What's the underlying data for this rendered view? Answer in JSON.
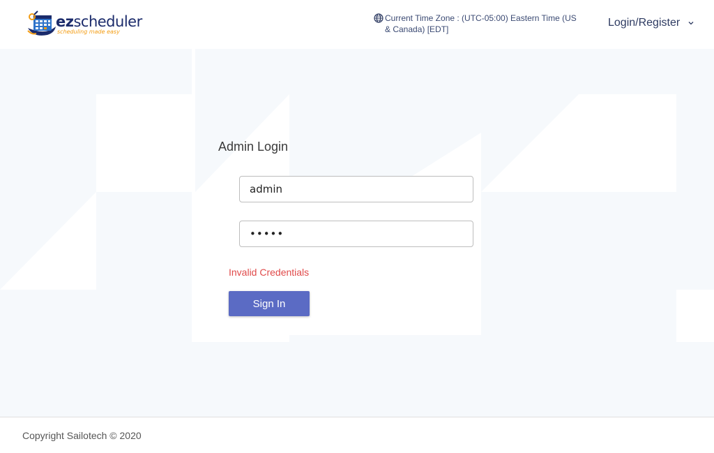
{
  "header": {
    "logo": {
      "brand_prefix": "ez",
      "brand_suffix": "scheduler",
      "tagline": "scheduling made easy"
    },
    "timezone": {
      "icon": "globe-icon",
      "text": "Current Time Zone : (UTC-05:00) Eastern Time (US & Canada) [EDT]"
    },
    "account_menu": {
      "label": "Login/Register",
      "icon": "chevron-down-icon"
    }
  },
  "login": {
    "title": "Admin Login",
    "username_value": "admin",
    "password_value": "•••••",
    "error": "Invalid Credentials",
    "submit_label": "Sign In"
  },
  "footer": {
    "copyright": "Copyright Sailotech © 2020"
  },
  "colors": {
    "brand_navy": "#1b2b6b",
    "brand_orange": "#f39c12",
    "button": "#5b6bc4",
    "error": "#e04a4a",
    "background_pattern": "#f6f9fc"
  }
}
